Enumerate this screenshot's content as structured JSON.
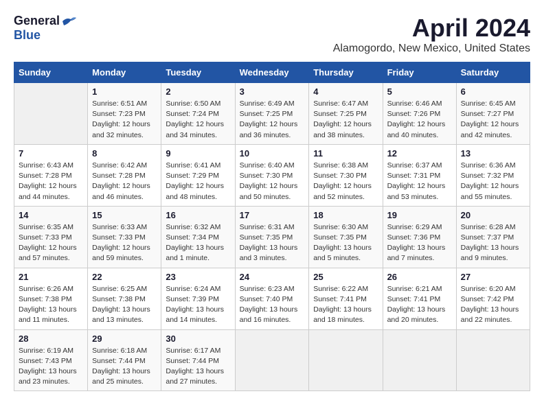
{
  "logo": {
    "general": "General",
    "blue": "Blue"
  },
  "title": "April 2024",
  "subtitle": "Alamogordo, New Mexico, United States",
  "days_of_week": [
    "Sunday",
    "Monday",
    "Tuesday",
    "Wednesday",
    "Thursday",
    "Friday",
    "Saturday"
  ],
  "weeks": [
    [
      {
        "day": "",
        "empty": true
      },
      {
        "day": "1",
        "sunrise": "Sunrise: 6:51 AM",
        "sunset": "Sunset: 7:23 PM",
        "daylight": "Daylight: 12 hours and 32 minutes."
      },
      {
        "day": "2",
        "sunrise": "Sunrise: 6:50 AM",
        "sunset": "Sunset: 7:24 PM",
        "daylight": "Daylight: 12 hours and 34 minutes."
      },
      {
        "day": "3",
        "sunrise": "Sunrise: 6:49 AM",
        "sunset": "Sunset: 7:25 PM",
        "daylight": "Daylight: 12 hours and 36 minutes."
      },
      {
        "day": "4",
        "sunrise": "Sunrise: 6:47 AM",
        "sunset": "Sunset: 7:25 PM",
        "daylight": "Daylight: 12 hours and 38 minutes."
      },
      {
        "day": "5",
        "sunrise": "Sunrise: 6:46 AM",
        "sunset": "Sunset: 7:26 PM",
        "daylight": "Daylight: 12 hours and 40 minutes."
      },
      {
        "day": "6",
        "sunrise": "Sunrise: 6:45 AM",
        "sunset": "Sunset: 7:27 PM",
        "daylight": "Daylight: 12 hours and 42 minutes."
      }
    ],
    [
      {
        "day": "7",
        "sunrise": "Sunrise: 6:43 AM",
        "sunset": "Sunset: 7:28 PM",
        "daylight": "Daylight: 12 hours and 44 minutes."
      },
      {
        "day": "8",
        "sunrise": "Sunrise: 6:42 AM",
        "sunset": "Sunset: 7:28 PM",
        "daylight": "Daylight: 12 hours and 46 minutes."
      },
      {
        "day": "9",
        "sunrise": "Sunrise: 6:41 AM",
        "sunset": "Sunset: 7:29 PM",
        "daylight": "Daylight: 12 hours and 48 minutes."
      },
      {
        "day": "10",
        "sunrise": "Sunrise: 6:40 AM",
        "sunset": "Sunset: 7:30 PM",
        "daylight": "Daylight: 12 hours and 50 minutes."
      },
      {
        "day": "11",
        "sunrise": "Sunrise: 6:38 AM",
        "sunset": "Sunset: 7:30 PM",
        "daylight": "Daylight: 12 hours and 52 minutes."
      },
      {
        "day": "12",
        "sunrise": "Sunrise: 6:37 AM",
        "sunset": "Sunset: 7:31 PM",
        "daylight": "Daylight: 12 hours and 53 minutes."
      },
      {
        "day": "13",
        "sunrise": "Sunrise: 6:36 AM",
        "sunset": "Sunset: 7:32 PM",
        "daylight": "Daylight: 12 hours and 55 minutes."
      }
    ],
    [
      {
        "day": "14",
        "sunrise": "Sunrise: 6:35 AM",
        "sunset": "Sunset: 7:33 PM",
        "daylight": "Daylight: 12 hours and 57 minutes."
      },
      {
        "day": "15",
        "sunrise": "Sunrise: 6:33 AM",
        "sunset": "Sunset: 7:33 PM",
        "daylight": "Daylight: 12 hours and 59 minutes."
      },
      {
        "day": "16",
        "sunrise": "Sunrise: 6:32 AM",
        "sunset": "Sunset: 7:34 PM",
        "daylight": "Daylight: 13 hours and 1 minute."
      },
      {
        "day": "17",
        "sunrise": "Sunrise: 6:31 AM",
        "sunset": "Sunset: 7:35 PM",
        "daylight": "Daylight: 13 hours and 3 minutes."
      },
      {
        "day": "18",
        "sunrise": "Sunrise: 6:30 AM",
        "sunset": "Sunset: 7:35 PM",
        "daylight": "Daylight: 13 hours and 5 minutes."
      },
      {
        "day": "19",
        "sunrise": "Sunrise: 6:29 AM",
        "sunset": "Sunset: 7:36 PM",
        "daylight": "Daylight: 13 hours and 7 minutes."
      },
      {
        "day": "20",
        "sunrise": "Sunrise: 6:28 AM",
        "sunset": "Sunset: 7:37 PM",
        "daylight": "Daylight: 13 hours and 9 minutes."
      }
    ],
    [
      {
        "day": "21",
        "sunrise": "Sunrise: 6:26 AM",
        "sunset": "Sunset: 7:38 PM",
        "daylight": "Daylight: 13 hours and 11 minutes."
      },
      {
        "day": "22",
        "sunrise": "Sunrise: 6:25 AM",
        "sunset": "Sunset: 7:38 PM",
        "daylight": "Daylight: 13 hours and 13 minutes."
      },
      {
        "day": "23",
        "sunrise": "Sunrise: 6:24 AM",
        "sunset": "Sunset: 7:39 PM",
        "daylight": "Daylight: 13 hours and 14 minutes."
      },
      {
        "day": "24",
        "sunrise": "Sunrise: 6:23 AM",
        "sunset": "Sunset: 7:40 PM",
        "daylight": "Daylight: 13 hours and 16 minutes."
      },
      {
        "day": "25",
        "sunrise": "Sunrise: 6:22 AM",
        "sunset": "Sunset: 7:41 PM",
        "daylight": "Daylight: 13 hours and 18 minutes."
      },
      {
        "day": "26",
        "sunrise": "Sunrise: 6:21 AM",
        "sunset": "Sunset: 7:41 PM",
        "daylight": "Daylight: 13 hours and 20 minutes."
      },
      {
        "day": "27",
        "sunrise": "Sunrise: 6:20 AM",
        "sunset": "Sunset: 7:42 PM",
        "daylight": "Daylight: 13 hours and 22 minutes."
      }
    ],
    [
      {
        "day": "28",
        "sunrise": "Sunrise: 6:19 AM",
        "sunset": "Sunset: 7:43 PM",
        "daylight": "Daylight: 13 hours and 23 minutes."
      },
      {
        "day": "29",
        "sunrise": "Sunrise: 6:18 AM",
        "sunset": "Sunset: 7:44 PM",
        "daylight": "Daylight: 13 hours and 25 minutes."
      },
      {
        "day": "30",
        "sunrise": "Sunrise: 6:17 AM",
        "sunset": "Sunset: 7:44 PM",
        "daylight": "Daylight: 13 hours and 27 minutes."
      },
      {
        "day": "",
        "empty": true
      },
      {
        "day": "",
        "empty": true
      },
      {
        "day": "",
        "empty": true
      },
      {
        "day": "",
        "empty": true
      }
    ]
  ]
}
